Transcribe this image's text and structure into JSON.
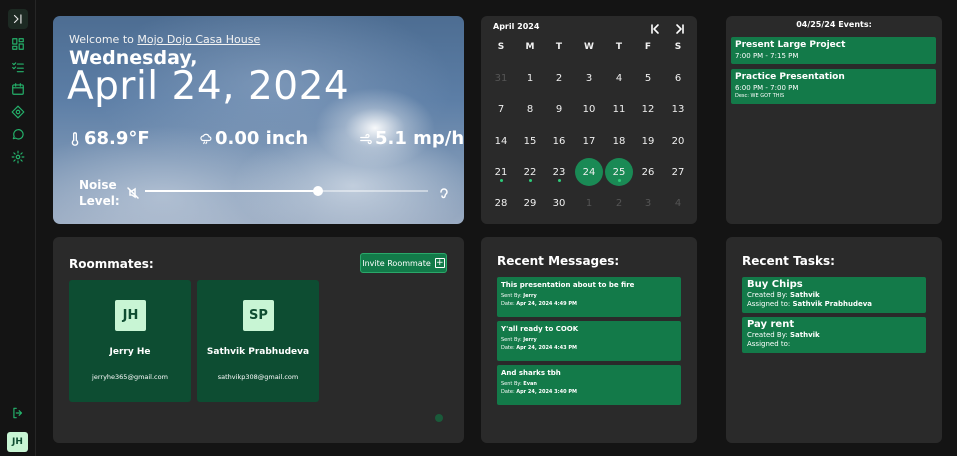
{
  "sidebar": {
    "avatar_initials": "JH",
    "items": [
      {
        "name": "collapse-toggle",
        "icon": "chevron-right-bar-icon"
      },
      {
        "name": "dashboard",
        "icon": "grid-icon"
      },
      {
        "name": "tasks",
        "icon": "checklist-icon"
      },
      {
        "name": "calendar",
        "icon": "calendar-icon"
      },
      {
        "name": "map",
        "icon": "location-icon"
      },
      {
        "name": "messages",
        "icon": "chat-icon"
      },
      {
        "name": "settings",
        "icon": "gear-icon"
      },
      {
        "name": "logout",
        "icon": "logout-icon"
      }
    ]
  },
  "weather": {
    "welcome_prefix": "Welcome to",
    "house_name": "Mojo Dojo Casa House",
    "weekday": "Wednesday,",
    "date": "April 24, 2024",
    "temperature": "68.9°F",
    "precipitation": "0.00 inch",
    "wind": "5.1 mp/h",
    "noise_label": "Noise Level:",
    "noise_level": 0.61
  },
  "calendar": {
    "month": "April 2024",
    "weekdays": [
      "S",
      "M",
      "T",
      "W",
      "T",
      "F",
      "S"
    ],
    "weeks": [
      [
        {
          "d": "31",
          "dim": true
        },
        {
          "d": "1"
        },
        {
          "d": "2"
        },
        {
          "d": "3"
        },
        {
          "d": "4"
        },
        {
          "d": "5"
        },
        {
          "d": "6"
        }
      ],
      [
        {
          "d": "7"
        },
        {
          "d": "8"
        },
        {
          "d": "9"
        },
        {
          "d": "10"
        },
        {
          "d": "11"
        },
        {
          "d": "12"
        },
        {
          "d": "13"
        }
      ],
      [
        {
          "d": "14"
        },
        {
          "d": "15"
        },
        {
          "d": "16"
        },
        {
          "d": "17"
        },
        {
          "d": "18"
        },
        {
          "d": "19"
        },
        {
          "d": "20"
        }
      ],
      [
        {
          "d": "21",
          "dot": true
        },
        {
          "d": "22",
          "dot": true
        },
        {
          "d": "23",
          "dot": true
        },
        {
          "d": "24",
          "selected": true
        },
        {
          "d": "25",
          "selected": true,
          "dot": true
        },
        {
          "d": "26"
        },
        {
          "d": "27"
        }
      ],
      [
        {
          "d": "28"
        },
        {
          "d": "29"
        },
        {
          "d": "30"
        },
        {
          "d": "1",
          "dim": true
        },
        {
          "d": "2",
          "dim": true
        },
        {
          "d": "3",
          "dim": true
        },
        {
          "d": "4",
          "dim": true
        }
      ]
    ],
    "accent": "#1a8a55"
  },
  "events": {
    "title": "04/25/24 Events:",
    "items": [
      {
        "name": "Present Large Project",
        "time": "7:00 PM - 7:15 PM",
        "desc": ""
      },
      {
        "name": "Practice Presentation",
        "time": "6:00 PM - 7:00 PM",
        "desc": "Desc: WE GOT THIS"
      }
    ]
  },
  "roommates": {
    "title": "Roommates:",
    "invite_label": "Invite Roommate",
    "people": [
      {
        "initials": "JH",
        "name": "Jerry He",
        "email": "jerryhe365@gmail.com"
      },
      {
        "initials": "SP",
        "name": "Sathvik Prabhudeva",
        "email": "sathvikp308@gmail.com"
      }
    ]
  },
  "messages": {
    "title": "Recent Messages:",
    "sent_by_label": "Sent By:",
    "date_label": "Date:",
    "items": [
      {
        "text": "This presentation about to be fire",
        "sender": "Jerry",
        "date": "Apr 24, 2024 4:49 PM"
      },
      {
        "text": "Y'all ready to COOK",
        "sender": "Jerry",
        "date": "Apr 24, 2024 4:43 PM"
      },
      {
        "text": "And sharks tbh",
        "sender": "Evan",
        "date": "Apr 24, 2024 3:40 PM"
      }
    ]
  },
  "tasks": {
    "title": "Recent Tasks:",
    "created_label": "Created By:",
    "assigned_label": "Assigned to:",
    "items": [
      {
        "name": "Buy Chips",
        "creator": "Sathvik",
        "assignee": "Sathvik Prabhudeva"
      },
      {
        "name": "Pay rent",
        "creator": "Sathvik",
        "assignee": ""
      }
    ]
  }
}
